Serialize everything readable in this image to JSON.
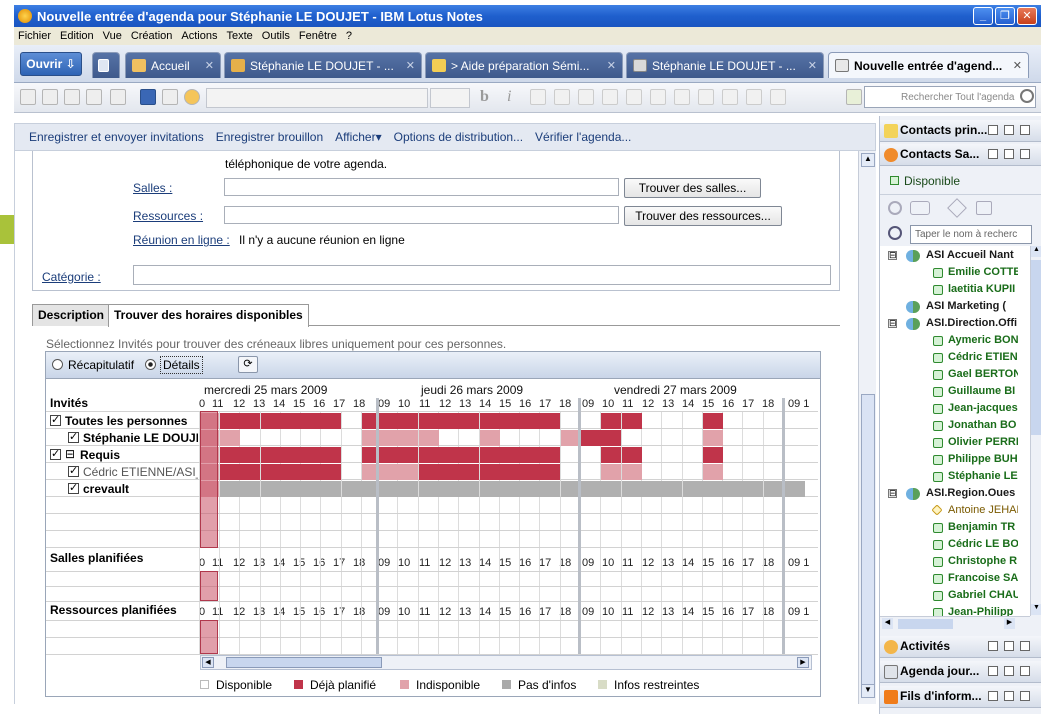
{
  "window": {
    "title": "Nouvelle entrée d'agenda pour Stéphanie LE DOUJET - IBM Lotus Notes",
    "controls": [
      "_",
      "❐",
      "✕"
    ]
  },
  "menu": [
    "Fichier",
    "Edition",
    "Vue",
    "Création",
    "Actions",
    "Texte",
    "Outils",
    "Fenêtre",
    "?"
  ],
  "open_button": "Ouvrir",
  "tabs": [
    {
      "label": "Accueil",
      "icon": "home-icon"
    },
    {
      "label": "Stéphanie LE DOUJET - ...",
      "icon": "mail-icon"
    },
    {
      "label": "> Aide préparation Sémi...",
      "icon": "house-doc-icon"
    },
    {
      "label": "Stéphanie LE DOUJET - ...",
      "icon": "calendar-icon"
    },
    {
      "label": "Nouvelle entrée d'agend...",
      "icon": "calendar-entry-icon",
      "active": true
    }
  ],
  "toolbar": {
    "bold": "b",
    "italic": "i",
    "search_placeholder": "Rechercher Tout l'agenda"
  },
  "actions": [
    "Enregistrer et envoyer invitations",
    "Enregistrer brouillon",
    "Afficher▾",
    "Options de distribution...",
    "Vérifier l'agenda..."
  ],
  "form": {
    "phone_text": "téléphonique de votre agenda.",
    "rooms_label": "Salles :",
    "rooms_button": "Trouver des salles...",
    "resources_label": "Ressources :",
    "resources_button": "Trouver des ressources...",
    "online_label": "Réunion en ligne :",
    "online_value": "Il n'y a aucune réunion en ligne",
    "category_label": "Catégorie :"
  },
  "subtabs": [
    "Description",
    "Trouver des horaires disponibles"
  ],
  "scheduler": {
    "hint": "Sélectionnez Invités pour trouver des créneaux libres uniquement pour ces personnes.",
    "mode_summary": "Récapitulatif",
    "mode_details": "Détails",
    "days": [
      "mercredi 25 mars 2009",
      "jeudi 26 mars 2009",
      "vendredi 27 mars 2009"
    ],
    "hours_day1": [
      "0",
      "11",
      "12",
      "13",
      "14",
      "15",
      "16",
      "17",
      "18"
    ],
    "hours_day": [
      "09",
      "10",
      "11",
      "12",
      "13",
      "14",
      "15",
      "16",
      "17",
      "18"
    ],
    "hours_tail": "09 1",
    "invites_header": "Invités",
    "rows": [
      {
        "label": "Toutes les personnes",
        "bold": true,
        "check": "✓",
        "tree": ""
      },
      {
        "label": "Stéphanie LE DOUJET",
        "bold": true,
        "check": "✓",
        "tree": ""
      },
      {
        "label": "Requis",
        "bold": true,
        "check": "✓",
        "tree": "⊟"
      },
      {
        "label": "Cédric ETIENNE/ASI_I",
        "bold": false,
        "check": "✓",
        "tree": ""
      },
      {
        "label": "crevault",
        "bold": true,
        "check": "✓",
        "tree": ""
      }
    ],
    "rooms_header": "Salles planifiées",
    "resources_header": "Ressources planifiées",
    "legend": [
      {
        "label": "Disponible",
        "color": "#ffffff"
      },
      {
        "label": "Déjà planifié",
        "color": "#c0344a"
      },
      {
        "label": "Indisponible",
        "color": "#e1a2aa"
      },
      {
        "label": "Pas d'infos",
        "color": "#aaaaaa"
      },
      {
        "label": "Infos restreintes",
        "color": "#d8dcc6"
      }
    ],
    "colors": {
      "busy": "#c0344a",
      "unavail": "#e1a2aa",
      "noinfo": "#b0b0b0",
      "free": "#ffffff"
    }
  },
  "right_panel": {
    "contacts_main": "Contacts prin...",
    "contacts_sa": "Contacts Sa...",
    "status": "Disponible",
    "search_placeholder": "Taper le nom à recherc",
    "tree": [
      {
        "type": "group",
        "label": "ASI Accueil Nant",
        "expand": "⊟"
      },
      {
        "type": "person",
        "label": "Emilie COTTE"
      },
      {
        "type": "person",
        "label": "laetitia KUPII"
      },
      {
        "type": "group",
        "label": "ASI Marketing (",
        "expand": ""
      },
      {
        "type": "group",
        "label": "ASI.Direction.Offi",
        "expand": "⊟"
      },
      {
        "type": "person",
        "label": "Aymeric BON"
      },
      {
        "type": "person",
        "label": "Cédric ETIENN"
      },
      {
        "type": "person",
        "label": "Gael BERTON"
      },
      {
        "type": "person",
        "label": "Guillaume BI"
      },
      {
        "type": "person",
        "label": "Jean-jacques"
      },
      {
        "type": "person",
        "label": "Jonathan BO"
      },
      {
        "type": "person",
        "label": "Olivier PERRI"
      },
      {
        "type": "person",
        "label": "Philippe BUHI"
      },
      {
        "type": "person",
        "label": "Stéphanie LE"
      },
      {
        "type": "group",
        "label": "ASI.Region.Oues",
        "expand": "⊟"
      },
      {
        "type": "person-away",
        "label": "Antoine JEHAN"
      },
      {
        "type": "person",
        "label": "Benjamin TR"
      },
      {
        "type": "person",
        "label": "Cédric LE BOF"
      },
      {
        "type": "person",
        "label": "Christophe R"
      },
      {
        "type": "person",
        "label": "Francoise SA"
      },
      {
        "type": "person",
        "label": "Gabriel CHAU"
      },
      {
        "type": "person",
        "label": "Jean-Philipp"
      }
    ],
    "activities": "Activités",
    "agenda": "Agenda jour...",
    "feeds": "Fils d'inform..."
  }
}
